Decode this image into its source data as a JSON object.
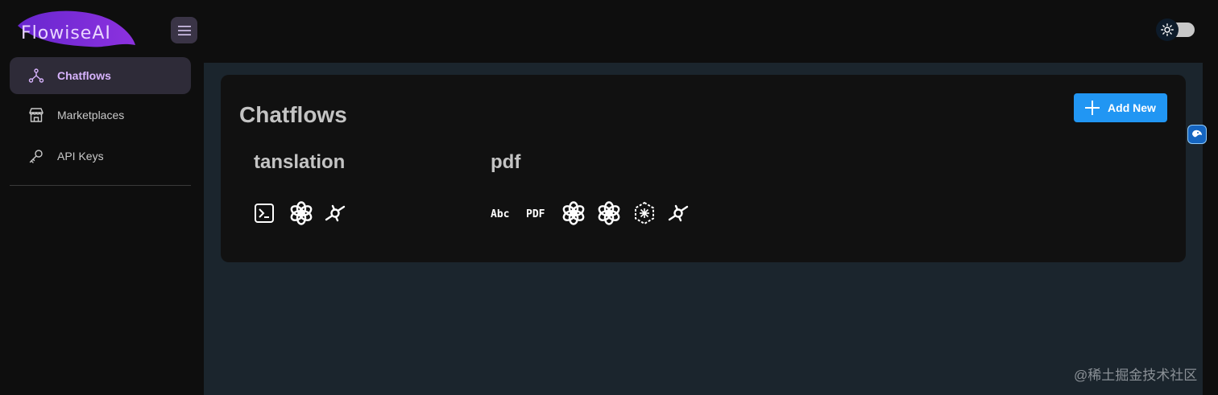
{
  "app": {
    "logo_text": "FlowiseAI"
  },
  "header": {
    "menu_icon": "hamburger-icon",
    "theme_icon": "sun-icon"
  },
  "sidebar": {
    "items": [
      {
        "label": "Chatflows",
        "icon": "hub-icon",
        "active": true
      },
      {
        "label": "Marketplaces",
        "icon": "store-icon",
        "active": false
      },
      {
        "label": "API Keys",
        "icon": "key-icon",
        "active": false
      }
    ]
  },
  "main": {
    "title": "Chatflows",
    "add_button_label": "Add New",
    "flows": [
      {
        "name": "tanslation",
        "icons": [
          "terminal-icon",
          "openai-icon",
          "chain-icon"
        ]
      },
      {
        "name": "pdf",
        "icons": [
          "text-splitter-icon",
          "pdf-icon",
          "openai-icon",
          "openai-icon",
          "vectorstore-icon",
          "chain-icon"
        ]
      }
    ]
  },
  "colors": {
    "accent": "#2196f3",
    "active_nav_text": "#d8b4fe",
    "logo_purple": "#7e22ce"
  },
  "watermark": "@稀土掘金技术社区"
}
